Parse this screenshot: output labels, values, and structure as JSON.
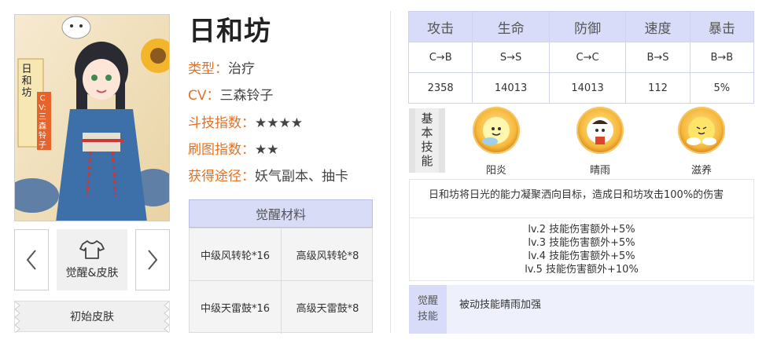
{
  "portrait": {
    "name_vertical": "日和坊",
    "cv_vertical": "CV:三森铃子"
  },
  "nav": {
    "prev_icon": "chevron-left",
    "next_icon": "chevron-right",
    "center_icon": "tshirt",
    "center_label": "觉醒&皮肤",
    "skin_label": "初始皮肤"
  },
  "info": {
    "name": "日和坊",
    "rows": [
      {
        "key": "类型：",
        "value": "治疗"
      },
      {
        "key": "CV：",
        "value": "三森铃子"
      },
      {
        "key": "斗技指数：",
        "value": "★★★★"
      },
      {
        "key": "刷图指数：",
        "value": "★★"
      },
      {
        "key": "获得途径：",
        "value": "妖气副本、抽卡"
      }
    ]
  },
  "materials": {
    "title": "觉醒材料",
    "items": [
      "中级风转轮*16",
      "高级风转轮*8",
      "中级天雷鼓*16",
      "高级天雷鼓*8"
    ]
  },
  "stats": {
    "headers": [
      "攻击",
      "生命",
      "防御",
      "速度",
      "暴击"
    ],
    "grades": [
      "C→B",
      "S→S",
      "C→C",
      "B→S",
      "B→B"
    ],
    "values": [
      "2358",
      "14013",
      "14013",
      "112",
      "5%"
    ]
  },
  "skills": {
    "tag": [
      "基",
      "本",
      "技",
      "能"
    ],
    "list": [
      {
        "name": "阳炎",
        "icon": "sun-spirit-icon"
      },
      {
        "name": "晴雨",
        "icon": "sunny-doll-icon"
      },
      {
        "name": "滋养",
        "icon": "cloud-sun-icon"
      }
    ],
    "description": "日和坊将日光的能力凝聚洒向目标，造成日和坊攻击100%的伤害",
    "levels": [
      "lv.2 技能伤害额外+5%",
      "lv.3 技能伤害额外+5%",
      "lv.4 技能伤害额外+5%",
      "lv.5 技能伤害额外+10%"
    ]
  },
  "awaken": {
    "tag_line1": "觉醒",
    "tag_line2": "技能",
    "text": "被动技能晴雨加强"
  },
  "colors": {
    "accent_orange": "#e67022",
    "header_blue": "#d9dcf8"
  }
}
